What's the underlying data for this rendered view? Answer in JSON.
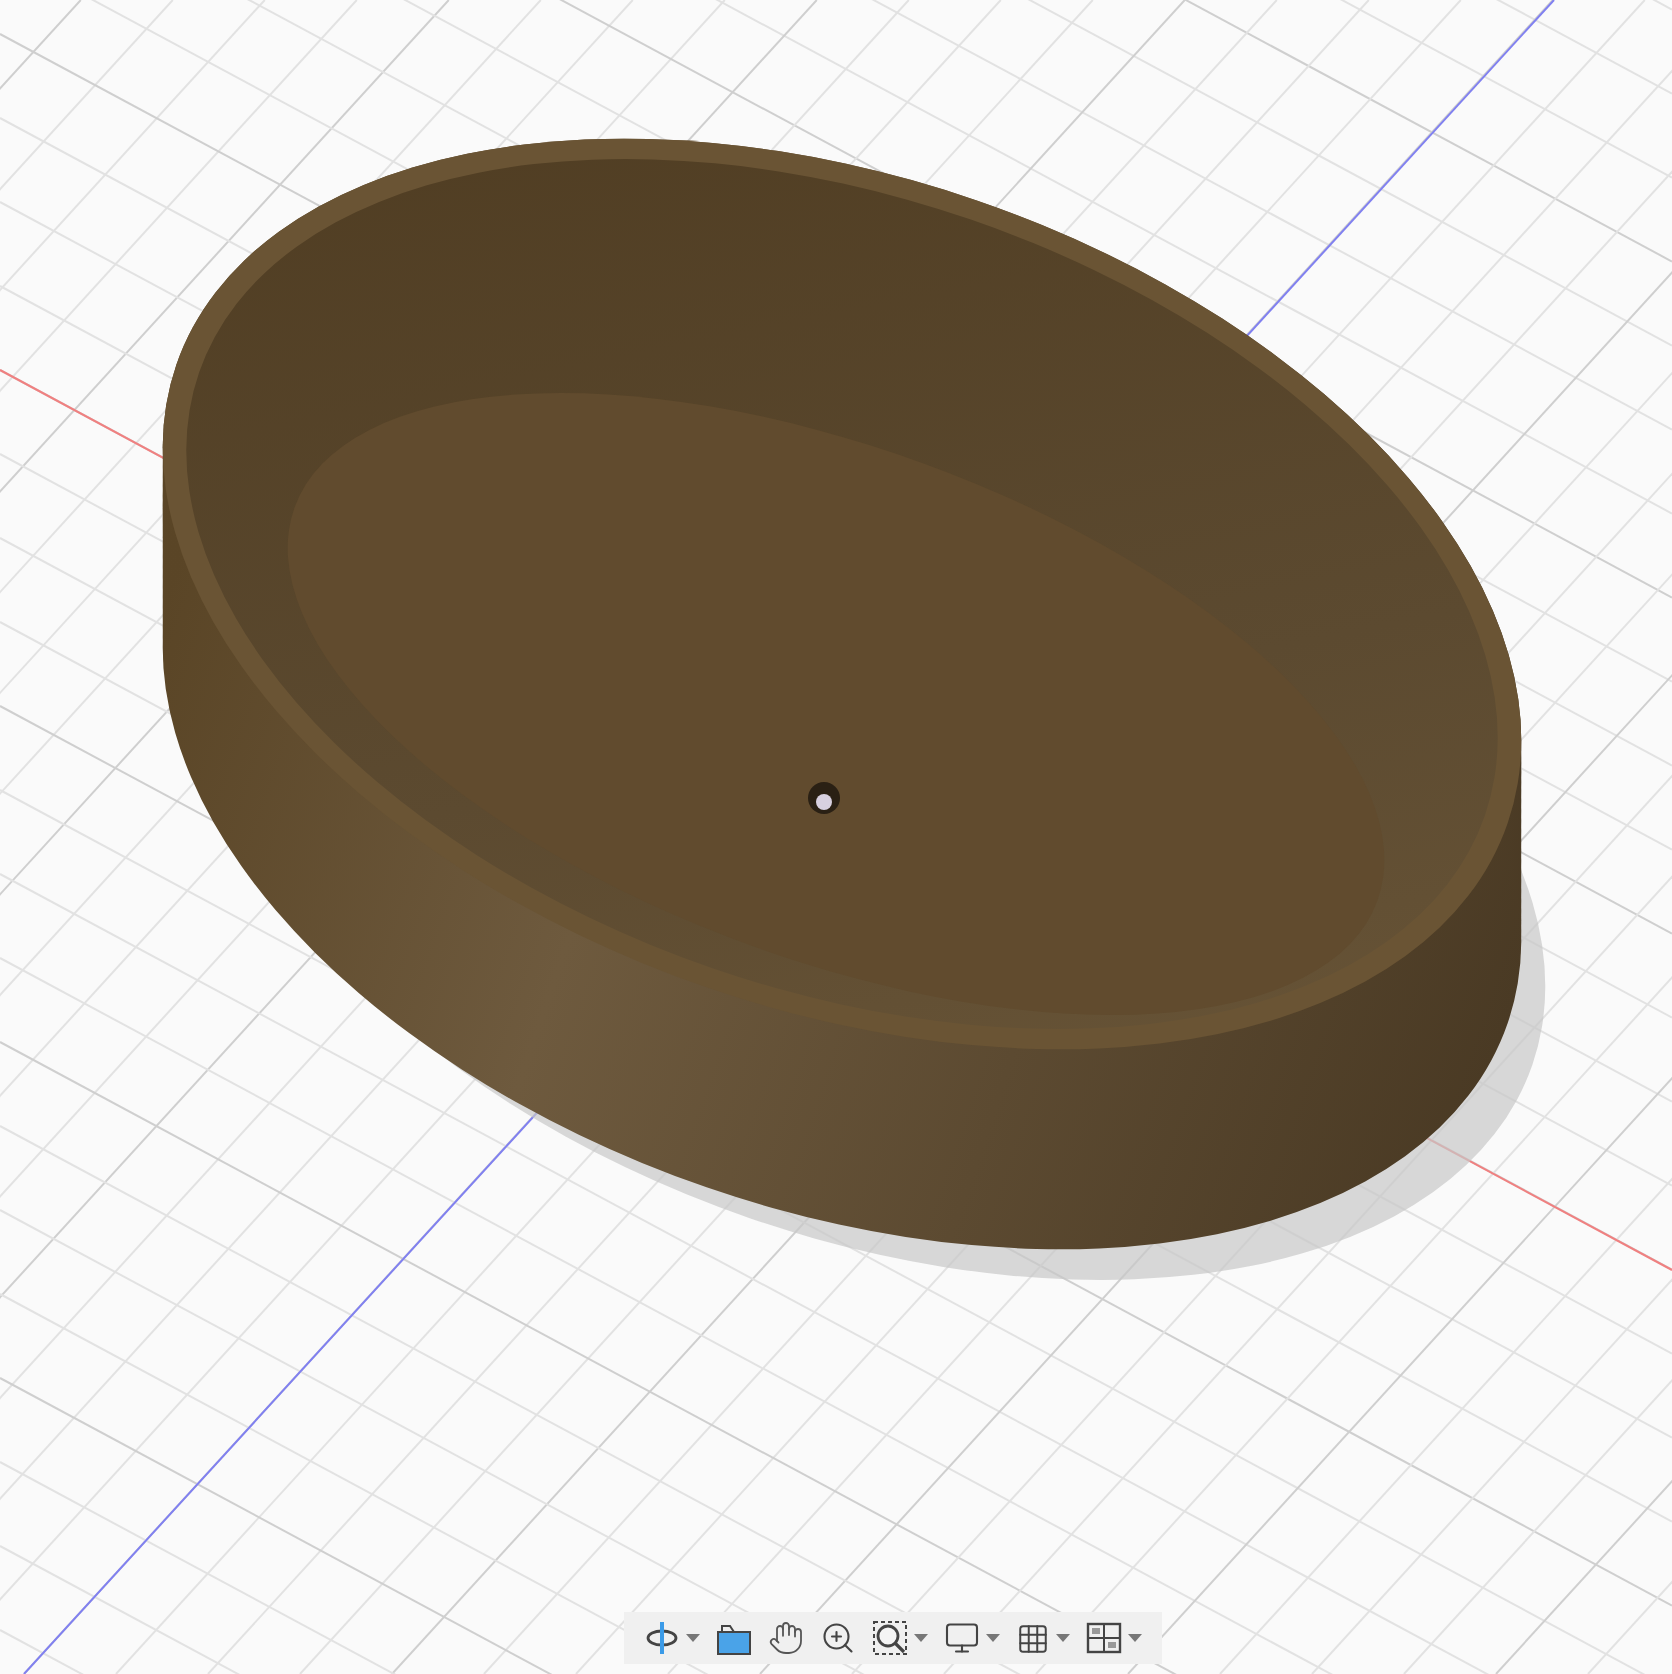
{
  "viewport": {
    "navigation_toolbar": [
      {
        "kind": "orbit",
        "dropdown": true
      },
      {
        "kind": "look_at",
        "dropdown": false
      },
      {
        "kind": "pan",
        "dropdown": false
      },
      {
        "kind": "zoom",
        "dropdown": false
      },
      {
        "kind": "fit",
        "dropdown": true
      },
      {
        "kind": "display",
        "dropdown": true
      },
      {
        "kind": "grid",
        "dropdown": true
      },
      {
        "kind": "viewports",
        "dropdown": true
      }
    ]
  }
}
